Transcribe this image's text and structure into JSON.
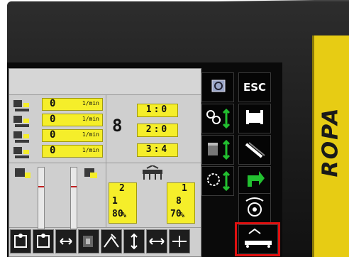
{
  "device": {
    "brand": "ROPA"
  },
  "rpm_rows": [
    {
      "value": "0",
      "unit": "1/min"
    },
    {
      "value": "0",
      "unit": "1/min"
    },
    {
      "value": "0",
      "unit": "1/min"
    },
    {
      "value": "0",
      "unit": "1/min"
    }
  ],
  "gear_label": "8",
  "ratios": [
    {
      "value": "1:0"
    },
    {
      "value": "2:0"
    },
    {
      "value": "3:4"
    }
  ],
  "left_column": {
    "top": "2",
    "mid": "1",
    "bottom": "80",
    "unit": "%"
  },
  "right_column": {
    "top": "1",
    "mid": "8",
    "bottom": "70",
    "unit": "%"
  },
  "soft_keys": {
    "esc_label": "ESC"
  },
  "colors": {
    "accent_yellow": "#f5ee2a",
    "brand_yellow": "#e7cc14",
    "highlight": "#e01010",
    "arrow_green": "#22c030"
  }
}
